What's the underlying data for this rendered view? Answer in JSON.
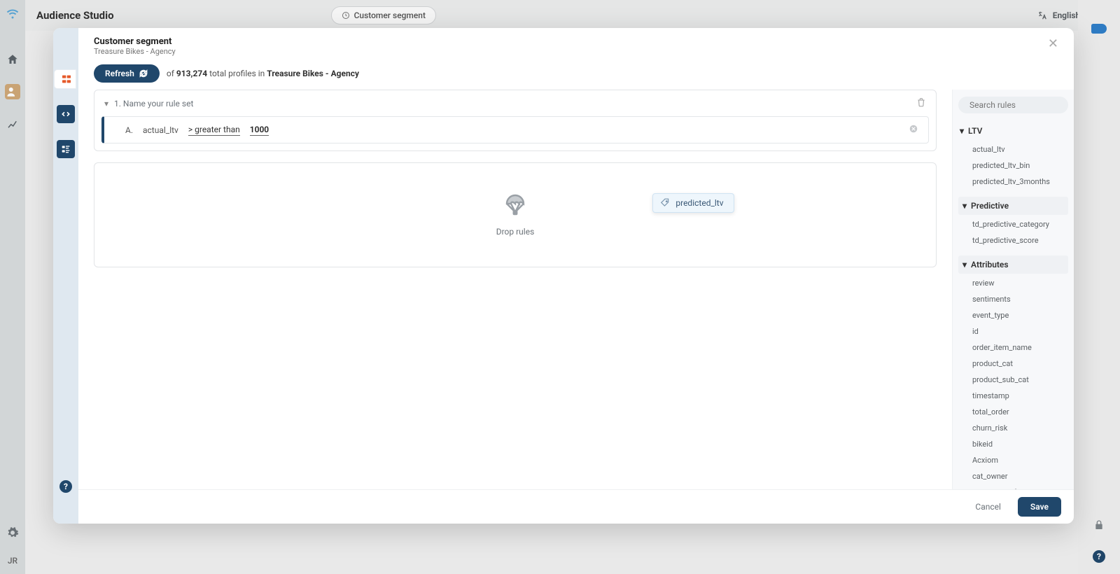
{
  "bg": {
    "app_title": "Audience Studio",
    "chip_label": "Customer segment",
    "language": "English (US)",
    "user_initials": "JR"
  },
  "modal": {
    "title": "Customer segment",
    "subtitle": "Treasure Bikes - Agency",
    "refresh_label": "Refresh",
    "profiles": {
      "prefix": "of ",
      "count": "913,274",
      "mid": " total profiles in ",
      "source": "Treasure Bikes - Agency"
    },
    "rule_set": {
      "name_prompt": "1. Name your rule set",
      "row": {
        "index": "A.",
        "field": "actual_ltv",
        "operator": "> greater than",
        "value": "1000"
      }
    },
    "drop_label": "Drop rules",
    "drag_chip": "predicted_ltv",
    "footer": {
      "cancel": "Cancel",
      "save": "Save"
    }
  },
  "rules_panel": {
    "search_placeholder": "Search rules",
    "groups": [
      {
        "name": "LTV",
        "items": [
          "actual_ltv",
          "predicted_ltv_bin",
          "predicted_ltv_3months"
        ]
      },
      {
        "name": "Predictive",
        "items": [
          "td_predictive_category",
          "td_predictive_score"
        ]
      },
      {
        "name": "Attributes",
        "items": [
          "review",
          "sentiments",
          "event_type",
          "id",
          "order_item_name",
          "product_cat",
          "product_sub_cat",
          "timestamp",
          "total_order",
          "churn_risk",
          "bikeid",
          "Acxiom",
          "cat_owner",
          "channel_preferene"
        ]
      }
    ]
  }
}
